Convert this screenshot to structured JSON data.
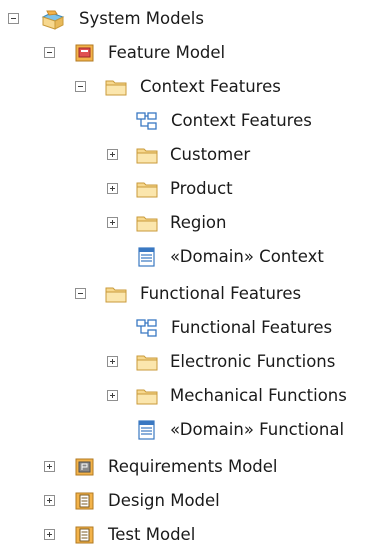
{
  "tree": {
    "nodes": [
      {
        "label": "System Models",
        "icon": "package-root-icon",
        "toggle": "expanded"
      },
      {
        "label": "Feature Model",
        "icon": "model-package-icon",
        "toggle": "expanded"
      },
      {
        "label": "Context Features",
        "icon": "folder-icon",
        "toggle": "expanded"
      },
      {
        "label": "Context Features",
        "icon": "diagram-icon",
        "toggle": "none"
      },
      {
        "label": "Customer",
        "icon": "folder-icon",
        "toggle": "collapsed"
      },
      {
        "label": "Product",
        "icon": "folder-icon",
        "toggle": "collapsed"
      },
      {
        "label": "Region",
        "icon": "folder-icon",
        "toggle": "collapsed"
      },
      {
        "label": "«Domain» Context",
        "icon": "domain-class-icon",
        "toggle": "none"
      },
      {
        "label": "Functional Features",
        "icon": "folder-icon",
        "toggle": "expanded"
      },
      {
        "label": "Functional Features",
        "icon": "diagram-icon",
        "toggle": "none"
      },
      {
        "label": "Electronic Functions",
        "icon": "folder-icon",
        "toggle": "collapsed"
      },
      {
        "label": "Mechanical Functions",
        "icon": "folder-icon",
        "toggle": "collapsed"
      },
      {
        "label": "«Domain» Functional",
        "icon": "domain-class-icon",
        "toggle": "none"
      },
      {
        "label": "Requirements Model",
        "icon": "requirements-model-icon",
        "toggle": "collapsed"
      },
      {
        "label": "Design Model",
        "icon": "design-model-icon",
        "toggle": "collapsed"
      },
      {
        "label": "Test Model",
        "icon": "test-model-icon",
        "toggle": "collapsed"
      }
    ]
  },
  "colors": {
    "folder": "#f7d88e",
    "folder_border": "#c99a3a",
    "model_red": "#e05050",
    "model_orange": "#f3b34a",
    "diagram_blue": "#3a78c2",
    "text": "#1a1a1a"
  }
}
